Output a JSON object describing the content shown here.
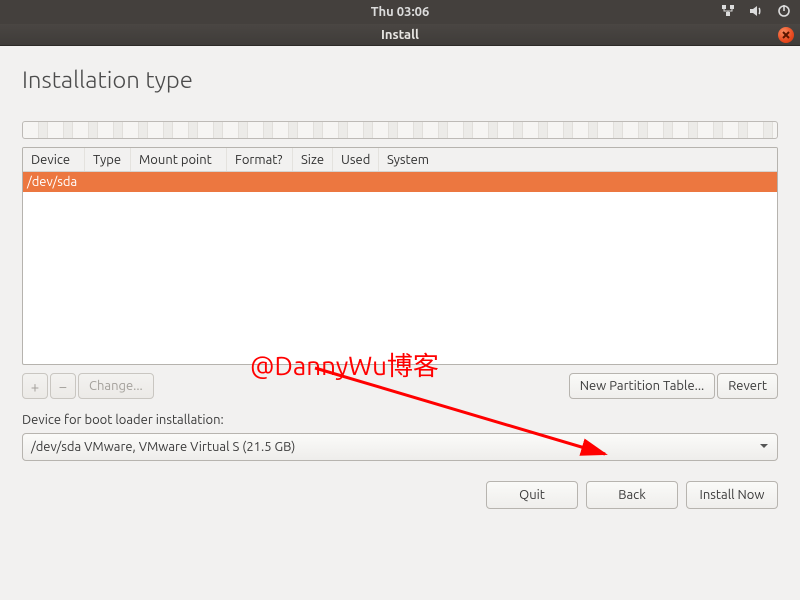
{
  "menubar": {
    "clock": "Thu 03:06"
  },
  "window": {
    "title": "Install"
  },
  "page": {
    "heading": "Installation type"
  },
  "table": {
    "headers": {
      "device": "Device",
      "type": "Type",
      "mount": "Mount point",
      "format": "Format?",
      "size": "Size",
      "used": "Used",
      "system": "System"
    },
    "rows": [
      {
        "device": "/dev/sda"
      }
    ]
  },
  "actions": {
    "add": "+",
    "remove": "−",
    "change": "Change...",
    "new_partition_table": "New Partition Table...",
    "revert": "Revert"
  },
  "bootloader": {
    "label": "Device for boot loader installation:",
    "selected": "/dev/sda VMware, VMware Virtual S (21.5 GB)"
  },
  "nav": {
    "quit": "Quit",
    "back": "Back",
    "install": "Install Now"
  },
  "annotation": {
    "watermark": "@DannyWu博客"
  }
}
